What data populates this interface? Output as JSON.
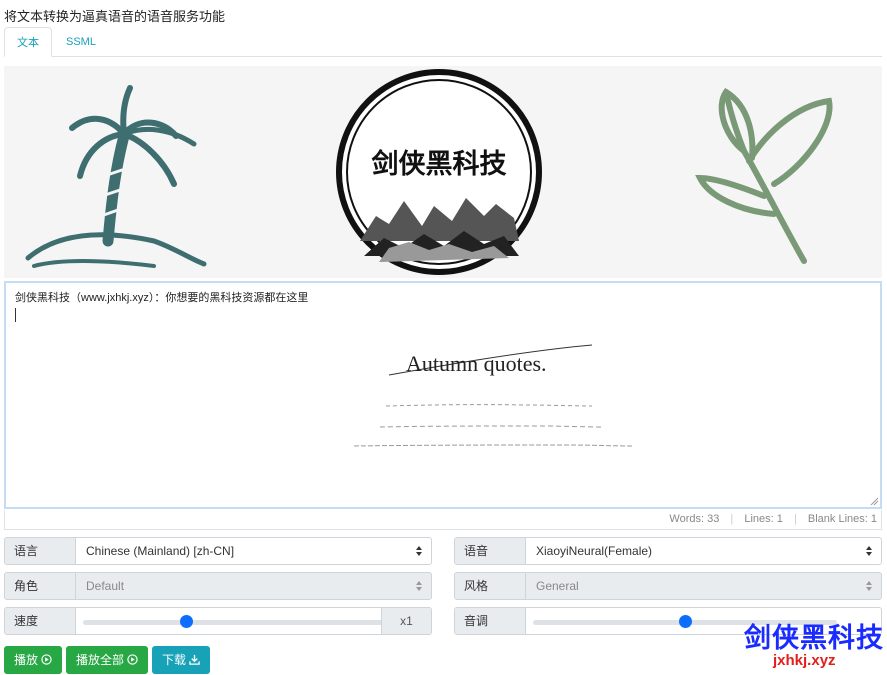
{
  "heading": "将文本转换为逼真语音的语音服务功能",
  "tabs": [
    {
      "label": "文本",
      "active": true
    },
    {
      "label": "SSML",
      "active": false
    }
  ],
  "banner": {
    "logo_text": "剑侠黑科技"
  },
  "editor": {
    "content": "剑侠黑科技（www.jxhkj.xyz）：你想要的黑科技资源都在这里",
    "bg_title": "Autumn quotes."
  },
  "stats": {
    "words_label": "Words:",
    "words": "33",
    "lines_label": "Lines:",
    "lines": "1",
    "blank_label": "Blank Lines:",
    "blank": "1"
  },
  "form": {
    "language": {
      "label": "语言",
      "value": "Chinese (Mainland) [zh-CN]"
    },
    "voice": {
      "label": "语音",
      "value": "XiaoyiNeural(Female)"
    },
    "role": {
      "label": "角色",
      "value": "Default"
    },
    "style": {
      "label": "风格",
      "value": "General"
    },
    "rate": {
      "label": "速度",
      "suffix": "x1",
      "level": 0.34
    },
    "pitch": {
      "label": "音调",
      "level": 0.5
    }
  },
  "buttons": {
    "play": "播放",
    "play_all": "播放全部",
    "download": "下载"
  },
  "watermark": {
    "title": "剑侠黑科技",
    "url": "jxhkj.xyz"
  },
  "colors": {
    "accent": "#17a2b8",
    "play": "#28a745",
    "slider": "#0d6efd",
    "watermark_title": "#1a2bff",
    "watermark_url": "#e0201c"
  }
}
